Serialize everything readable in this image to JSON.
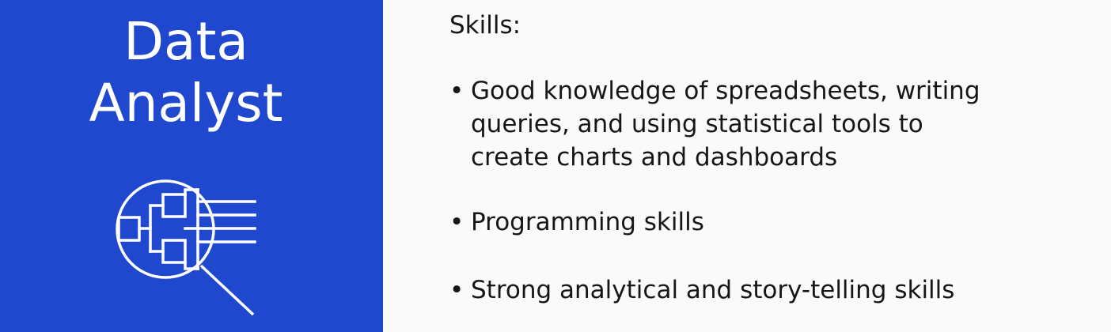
{
  "left_panel": {
    "title_line1": "Data",
    "title_line2": "Analyst",
    "icon": "magnifier-flowchart-icon",
    "background_color": "#2048cf",
    "text_color": "#ffffff"
  },
  "right_panel": {
    "heading": "Skills:",
    "bullet": "•",
    "items": [
      "Good knowledge of spreadsheets, writing queries, and using statistical tools to create charts and dashboards",
      "Programming skills",
      "Strong analytical and story-telling skills"
    ]
  }
}
